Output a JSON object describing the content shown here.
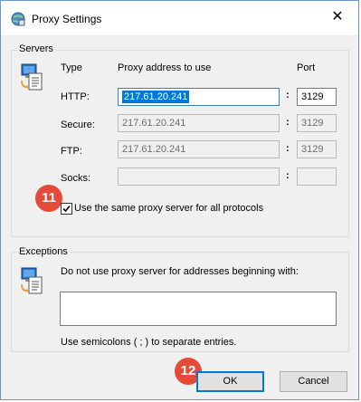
{
  "window": {
    "title": "Proxy Settings",
    "close_glyph": "✕"
  },
  "servers": {
    "group_label": "Servers",
    "col_type": "Type",
    "col_address": "Proxy address to use",
    "col_port": "Port",
    "rows": [
      {
        "label": "HTTP:",
        "address": "217.61.20.241",
        "port": "3129"
      },
      {
        "label": "Secure:",
        "address": "217.61.20.241",
        "port": "3129"
      },
      {
        "label": "FTP:",
        "address": "217.61.20.241",
        "port": "3129"
      },
      {
        "label": "Socks:",
        "address": "",
        "port": ""
      }
    ],
    "colon": ":",
    "same_proxy_label": "Use the same proxy server for all protocols",
    "same_proxy_checked": true
  },
  "exceptions": {
    "group_label": "Exceptions",
    "description": "Do not use proxy server for addresses beginning with:",
    "value": "",
    "hint": "Use semicolons ( ; ) to separate entries."
  },
  "buttons": {
    "ok": "OK",
    "cancel": "Cancel"
  },
  "badges": {
    "checkbox_step": "11",
    "ok_step": "12"
  },
  "colors": {
    "badge": "#e64a3b",
    "selection": "#0078d7"
  },
  "icons": {
    "app": "proxy-settings-icon",
    "network": "network-computer-icon",
    "document": "document-icon"
  }
}
